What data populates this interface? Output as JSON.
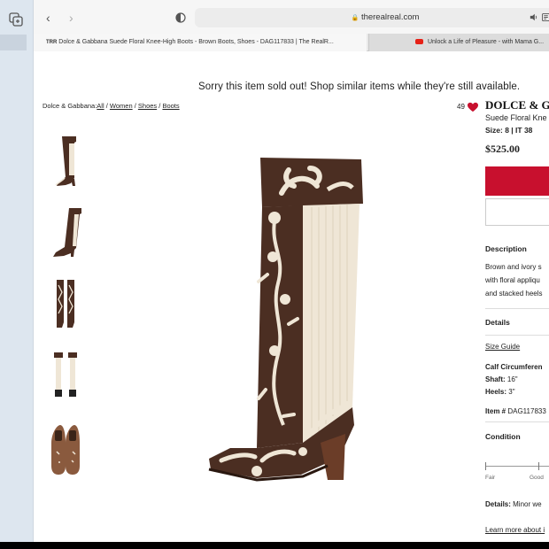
{
  "browser": {
    "url": "therealreal.com",
    "tabs": [
      {
        "label": "Dolce & Gabbana Suede Floral Knee-High Boots - Brown Boots, Shoes - DAG117833 | The RealR..."
      },
      {
        "label": "Unlock a Life of Pleasure - with Mama G..."
      }
    ]
  },
  "page": {
    "banner": "Sorry this item sold out! Shop similar items while they're still available.",
    "breadcrumb": {
      "brand": "Dolce & Gabbana:",
      "all": "All",
      "sep1": " / ",
      "women": "Women",
      "sep2": " / ",
      "shoes": "Shoes",
      "sep3": " / ",
      "boots": "Boots"
    },
    "product": {
      "likes": "49",
      "brand": "DOLCE & G",
      "name": "Suede Floral Kne",
      "size": "Size: 8 | IT 38",
      "price": "$525.00"
    },
    "description": {
      "heading": "Description",
      "lines": [
        "Brown and ivory s",
        "with floral appliqu",
        "and stacked heels"
      ]
    },
    "details": {
      "heading": "Details",
      "size_guide": "Size Guide",
      "calf": "Calf Circumferen",
      "shaft_label": "Shaft:",
      "shaft_value": " 16\"",
      "heels_label": "Heels:",
      "heels_value": " 3\"",
      "item_label": "Item #",
      "item_value": " DAG117833"
    },
    "condition": {
      "heading": "Condition",
      "scale": [
        "Fair",
        "Good"
      ],
      "details_label": "Details:",
      "details_value": " Minor we",
      "learn_more": "Learn more about i"
    }
  },
  "colors": {
    "accent": "#c8102e",
    "boot_brown": "#4b2e22",
    "boot_ivory": "#efe6d6",
    "heel": "#6b3d28"
  }
}
